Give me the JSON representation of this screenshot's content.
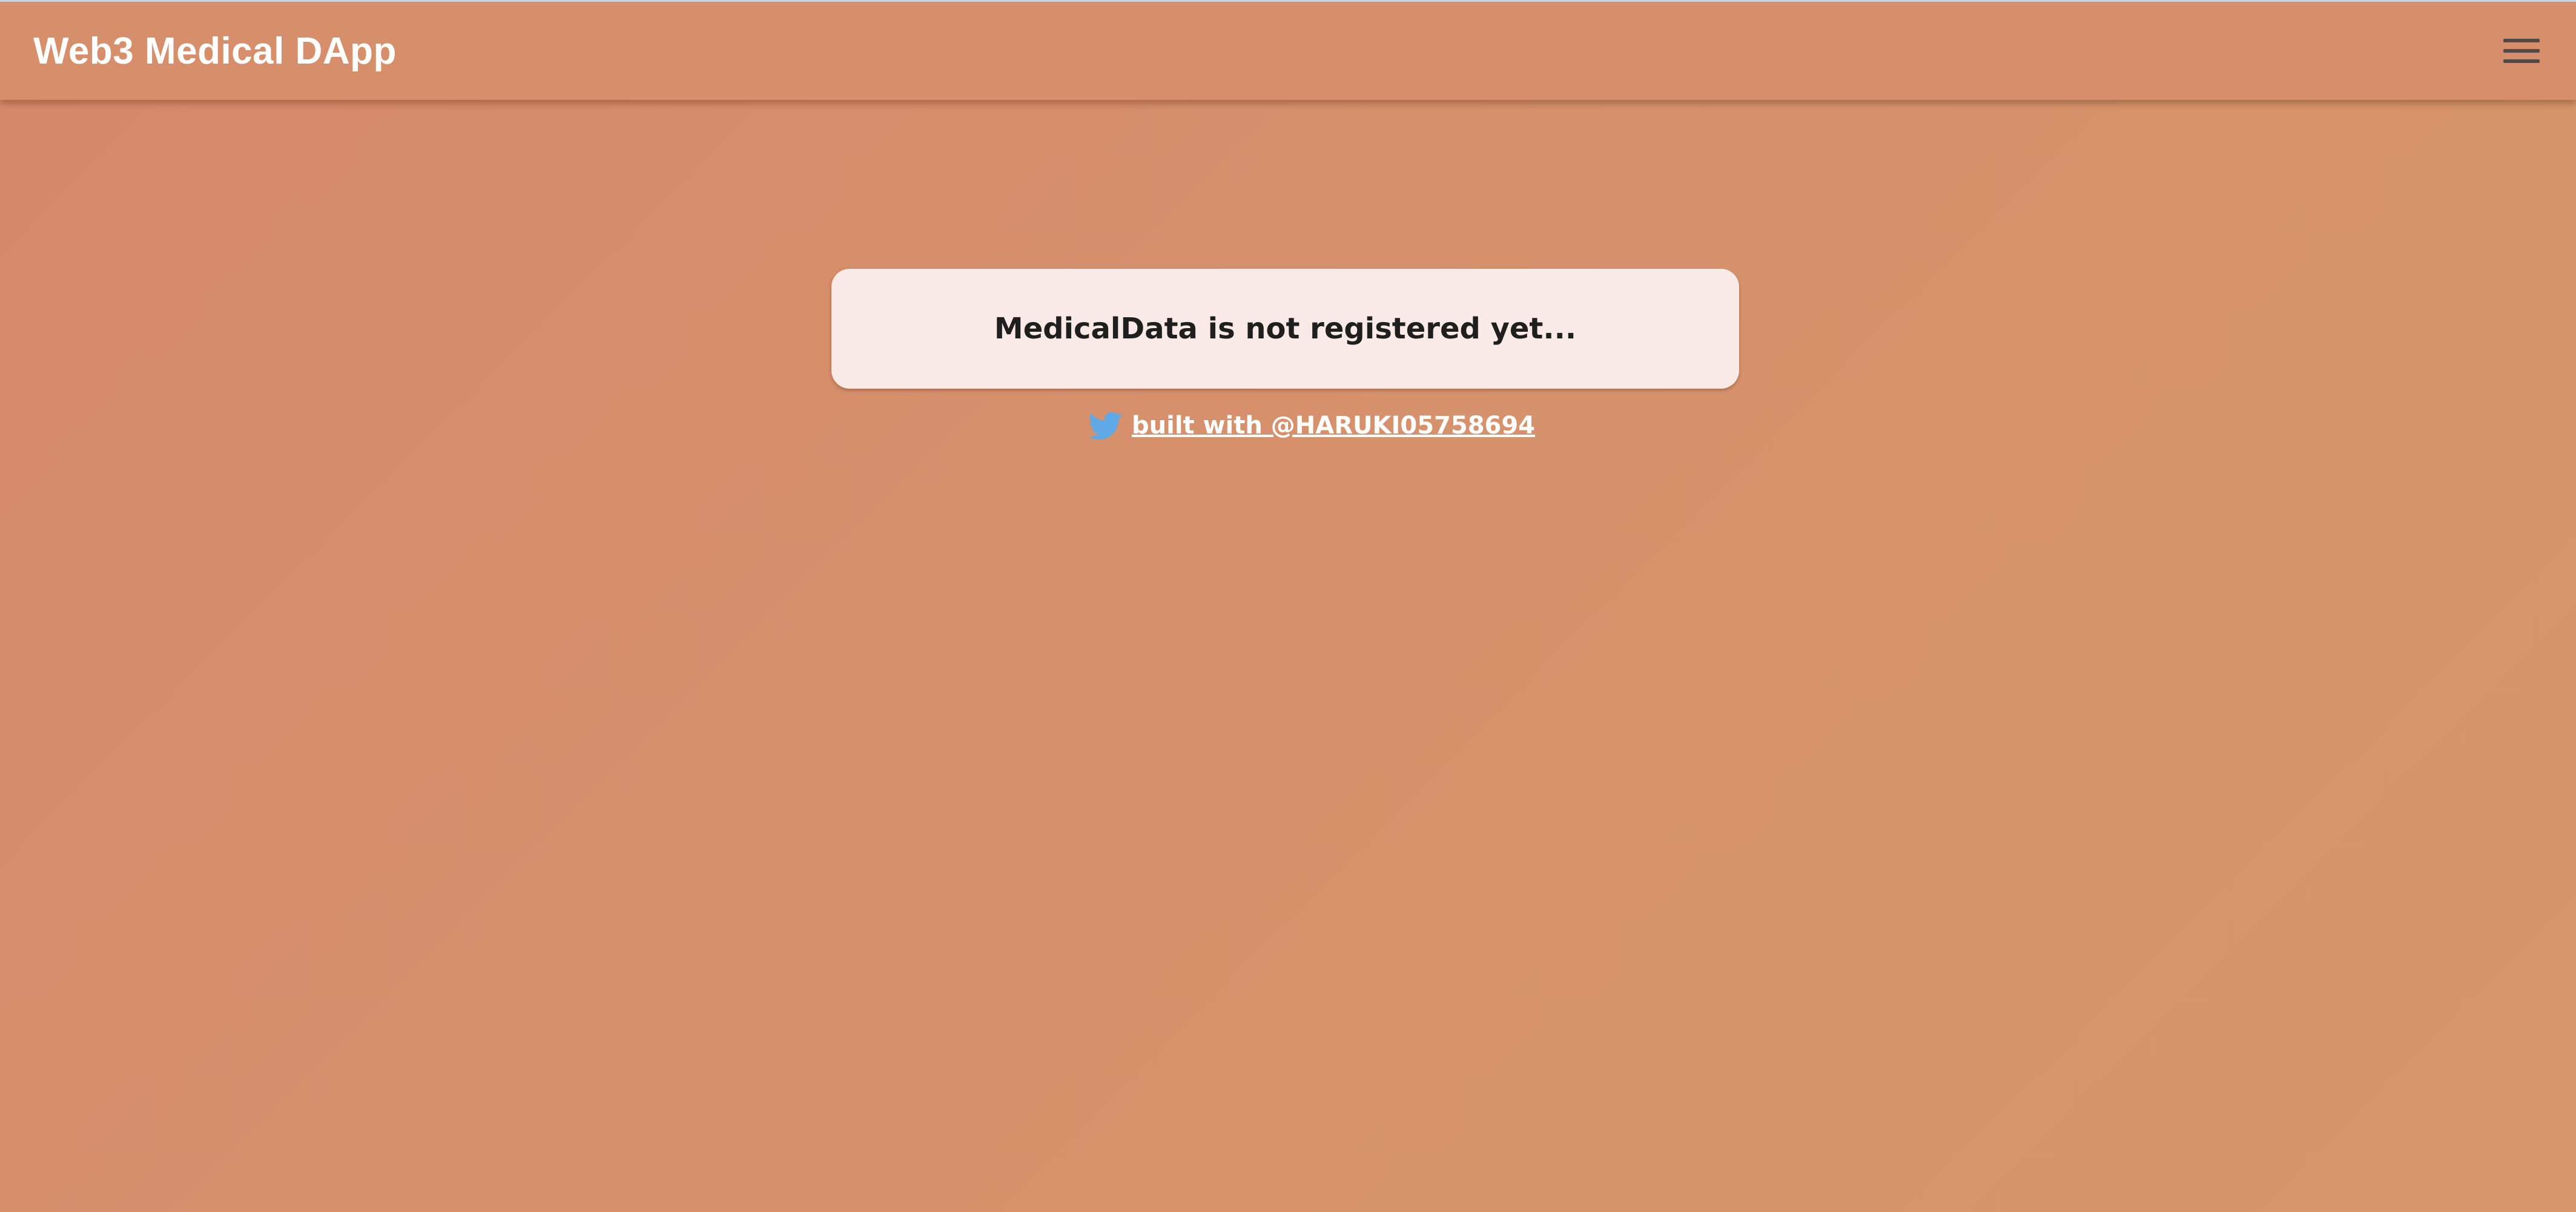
{
  "header": {
    "title": "Web3 Medical DApp",
    "menu_icon": "hamburger-menu-icon"
  },
  "main": {
    "status_message": "MedicalData is not registered yet...",
    "credit": {
      "icon": "twitter-bird-icon",
      "link_text": "built with @HARUKI05758694"
    }
  },
  "colors": {
    "background": "#d68f6a",
    "card": "#faeae7",
    "twitter_blue": "#5ea9e6",
    "title_text": "#ffffff"
  }
}
